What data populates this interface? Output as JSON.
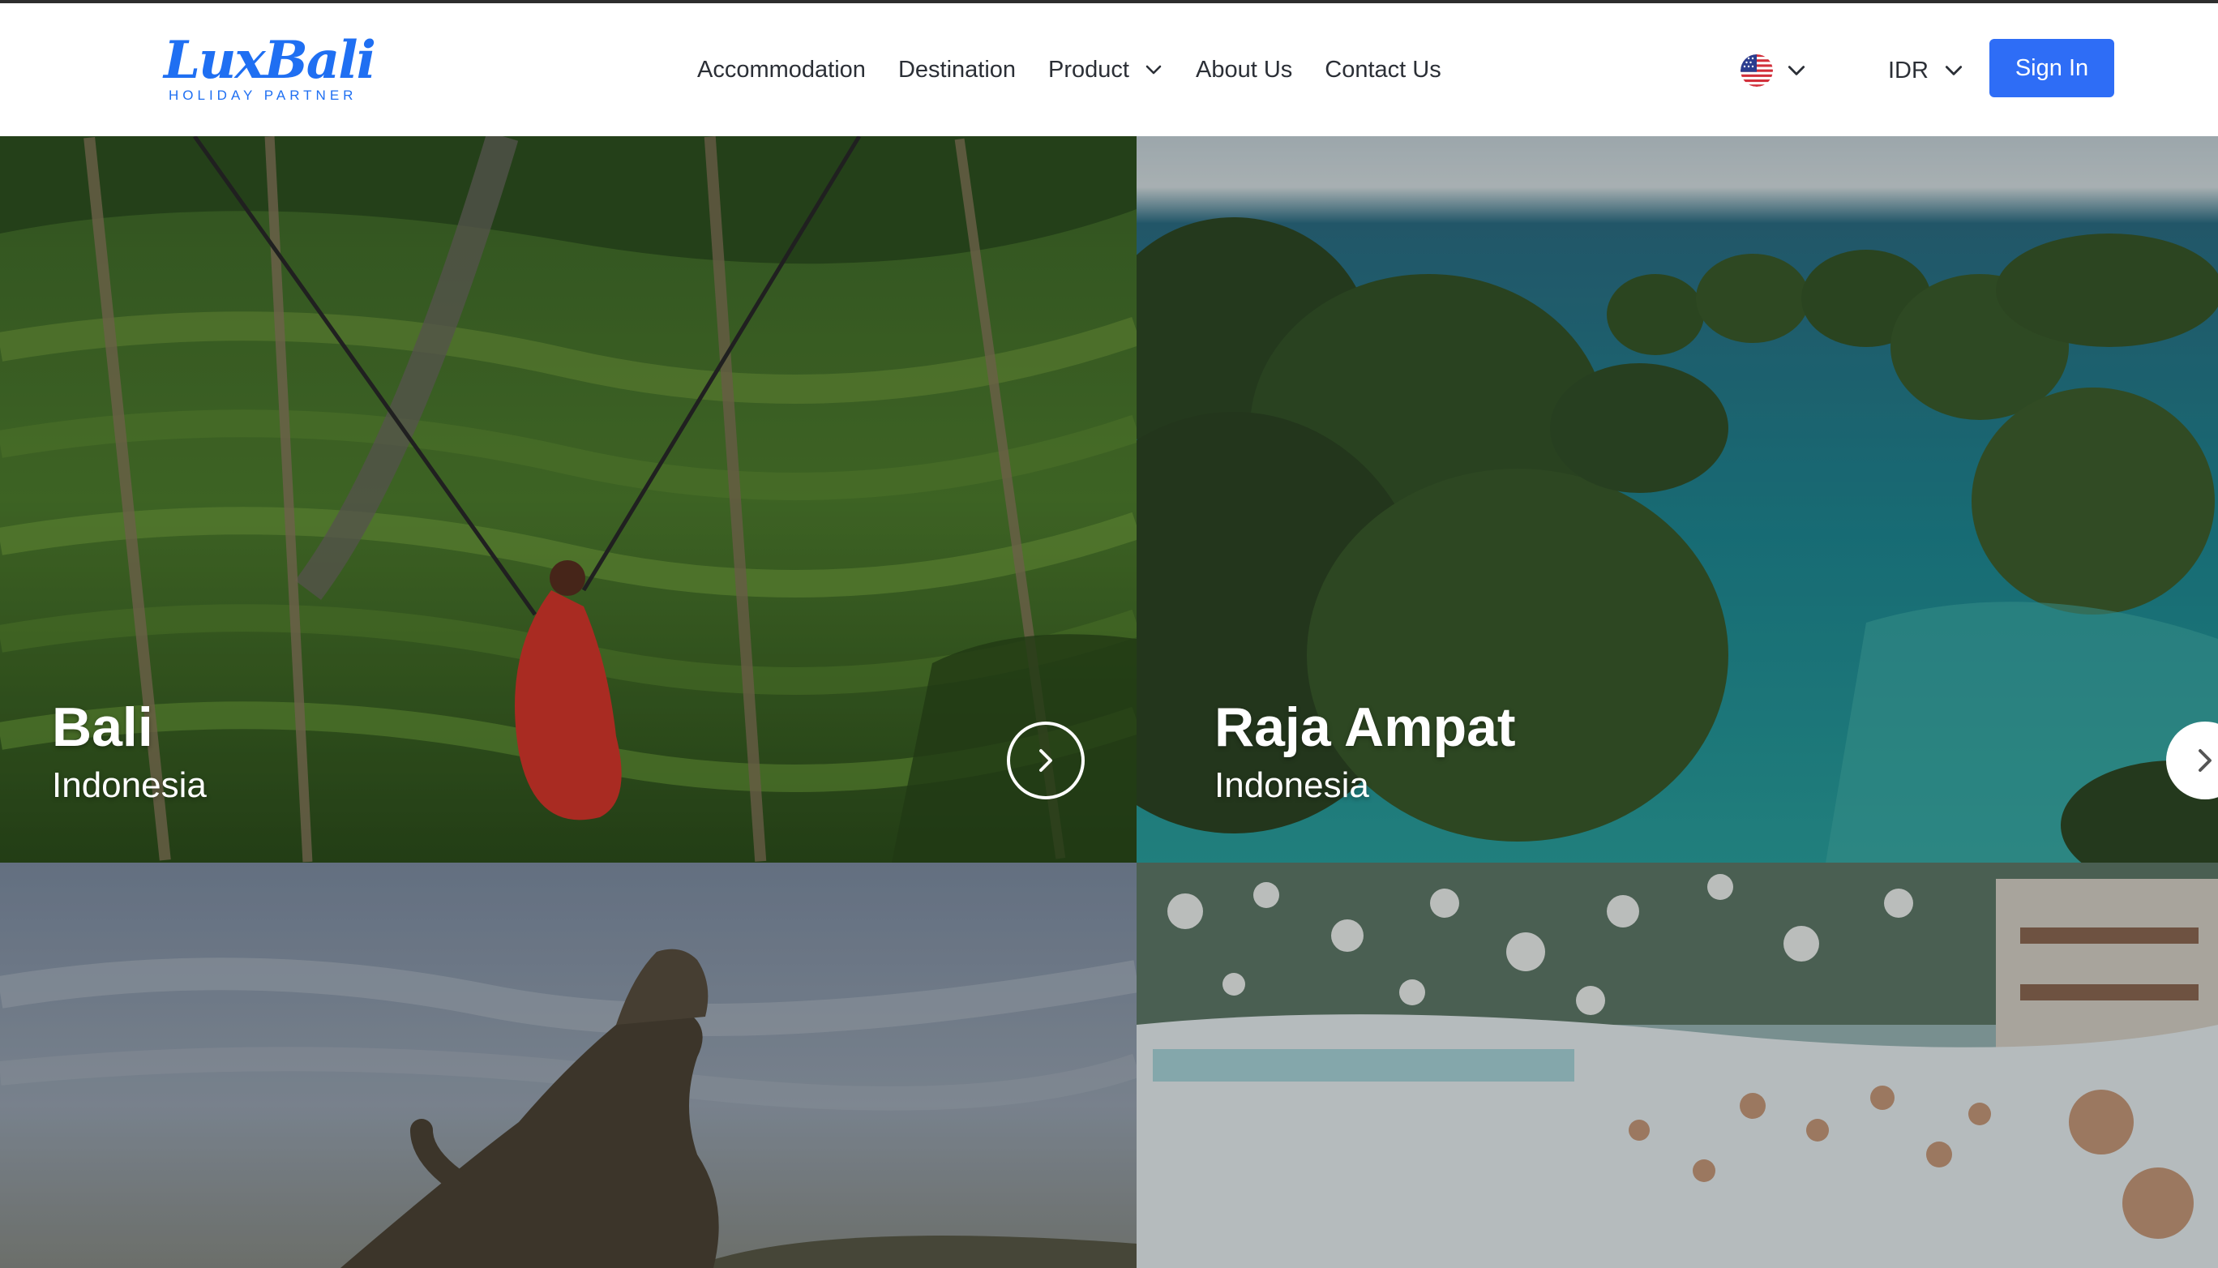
{
  "brand": {
    "name": "LuxBali",
    "tagline": "HOLIDAY PARTNER",
    "color": "#1f6ff2"
  },
  "nav": {
    "items": [
      {
        "label": "Accommodation"
      },
      {
        "label": "Destination"
      },
      {
        "label": "Product",
        "has_dropdown": true
      },
      {
        "label": "About Us"
      },
      {
        "label": "Contact Us"
      }
    ]
  },
  "language": {
    "flag_icon": "us-flag-icon"
  },
  "currency": {
    "selected": "IDR"
  },
  "auth": {
    "sign_in_label": "Sign In",
    "accent": "#2e6df6"
  },
  "destinations": [
    {
      "name": "Bali",
      "country": "Indonesia",
      "scene": "rice-terrace-swing"
    },
    {
      "name": "Raja Ampat",
      "country": "Indonesia",
      "scene": "karst-islands-lagoon"
    },
    {
      "name": "",
      "country": "",
      "scene": "komodo-dragons"
    },
    {
      "name": "",
      "country": "",
      "scene": "foam-pool-party"
    }
  ]
}
